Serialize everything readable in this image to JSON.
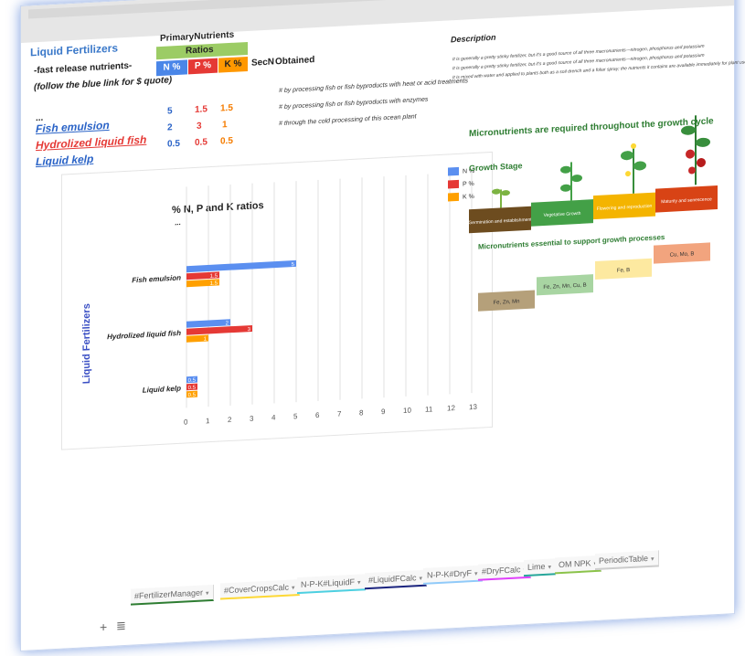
{
  "sheet": {
    "title": "Liquid Fertilizers",
    "primary_header": "PrimaryNutrients",
    "ratios_header": "Ratios",
    "fast_release": "-fast release nutrients-",
    "follow_link": "(follow the blue link for $ quote)",
    "col_n": "N %",
    "col_p": "P %",
    "col_k": "K %",
    "col_secn": "SecN",
    "col_obtained": "Obtained",
    "col_description": "Description",
    "ellipsis_row": "...",
    "products": [
      {
        "name": "Fish emulsion",
        "n": "5",
        "p": "1.5",
        "k": "1.5",
        "obtained": "# by processing fish or fish byproducts with heat or acid treatments",
        "description": "It is generally a pretty stinky fertilizer, but it's a good source of all three macronutrients—nitrogen, phosphorus and potassium"
      },
      {
        "name": "Hydrolized liquid fish",
        "n": "2",
        "p": "3",
        "k": "1",
        "obtained": "# by processing fish or fish byproducts with enzymes",
        "description": "It is generally a pretty stinky fertilizer, but it's a good source of all three macronutrients—nitrogen, phosphorus and potassium"
      },
      {
        "name": "Liquid kelp",
        "n": "0.5",
        "p": "0.5",
        "k": "0.5",
        "obtained": "# through the cold processing of this ocean plant",
        "description": "It is mixed with water and applied to plants both as a soil drench and a foliar spray; the nutrients it contains are available immediately for plant use"
      }
    ]
  },
  "chart_data": {
    "type": "bar",
    "orientation": "horizontal",
    "title": "% N, P and K ratios",
    "ylabel": "Liquid Fertilizers",
    "categories": [
      "...",
      "Fish emulsion",
      "Hydrolized liquid fish",
      "Liquid kelp"
    ],
    "series": [
      {
        "name": "N %",
        "color": "#5b8ff0",
        "values": [
          0,
          5,
          2,
          0.5
        ]
      },
      {
        "name": "P %",
        "color": "#e53935",
        "values": [
          0,
          1.5,
          3,
          0.5
        ]
      },
      {
        "name": "K %",
        "color": "#ffa000",
        "values": [
          0,
          1.5,
          1,
          0.5
        ]
      }
    ],
    "xlim": [
      0,
      13
    ],
    "xticks": [
      "0",
      "1",
      "2",
      "3",
      "4",
      "5",
      "6",
      "7",
      "8",
      "9",
      "10",
      "11",
      "12",
      "13"
    ],
    "grid": true,
    "legend": "top-right"
  },
  "infographic": {
    "title": "Micronutrients are required throughout the growth cycle",
    "growth_stage_label": "Growth Stage",
    "stages": [
      {
        "label": "Germination and establishment",
        "color": "#6d4c1f"
      },
      {
        "label": "Vegetative Growth",
        "color": "#43a047"
      },
      {
        "label": "Flowering and reproduction",
        "color": "#f4b400"
      },
      {
        "label": "Maturity and senescence",
        "color": "#d84315"
      }
    ],
    "micro_label": "Micronutrients essential to support growth processes",
    "micros": [
      {
        "label": "Fe, Zn, Mn",
        "color": "#b5a07a"
      },
      {
        "label": "Fe, Zn, Mn, Cu, B",
        "color": "#a8d5a2"
      },
      {
        "label": "Fe, B",
        "color": "#fde9a0"
      },
      {
        "label": "Cu, Mo, B",
        "color": "#f2a47e"
      }
    ]
  },
  "tabs": [
    {
      "label": "#FertilizerManager",
      "color": "#2e7d32"
    },
    {
      "label": "#CoverCropsCalc",
      "color": "#fdd835"
    },
    {
      "label": "N-P-K#LiquidF",
      "color": "#4dd0e1"
    },
    {
      "label": "#LiquidFCalc",
      "color": "#1a237e"
    },
    {
      "label": "N-P-K#DryF",
      "color": "#90caf9"
    },
    {
      "label": "#DryFCalc",
      "color": "#e040fb"
    },
    {
      "label": "Lime",
      "color": "#26a69a"
    },
    {
      "label": "OM NPK",
      "color": "#8bc34a"
    },
    {
      "label": "PeriodicTable",
      "color": "#cccccc"
    }
  ],
  "tab_dropdown_glyph": "▾",
  "add_sheet_glyph": "+",
  "all_sheets_glyph": "≣",
  "icons": [
    "add-sheet-icon",
    "all-sheets-icon",
    "tab-dropdown-icon"
  ]
}
